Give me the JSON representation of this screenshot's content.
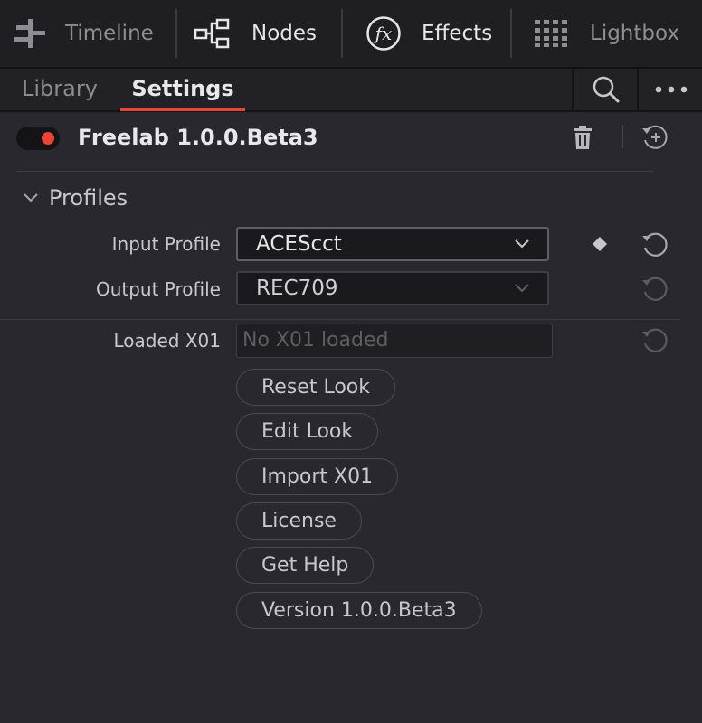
{
  "top_tabs": {
    "timeline": "Timeline",
    "nodes": "Nodes",
    "effects": "Effects",
    "lightbox": "Lightbox"
  },
  "sub_tabs": {
    "library": "Library",
    "settings": "Settings"
  },
  "plugin": {
    "title": "Freelab 1.0.0.Beta3",
    "enabled": true
  },
  "profiles": {
    "section_title": "Profiles",
    "input_label": "Input Profile",
    "input_value": "ACEScct",
    "output_label": "Output Profile",
    "output_value": "REC709",
    "loaded_label": "Loaded X01",
    "loaded_placeholder": "No X01 loaded"
  },
  "buttons": {
    "reset_look": "Reset Look",
    "edit_look": "Edit Look",
    "import_x01": "Import X01",
    "license": "License",
    "get_help": "Get Help",
    "version": "Version 1.0.0.Beta3"
  },
  "colors": {
    "accent": "#e8463a",
    "background": "#28282e"
  }
}
